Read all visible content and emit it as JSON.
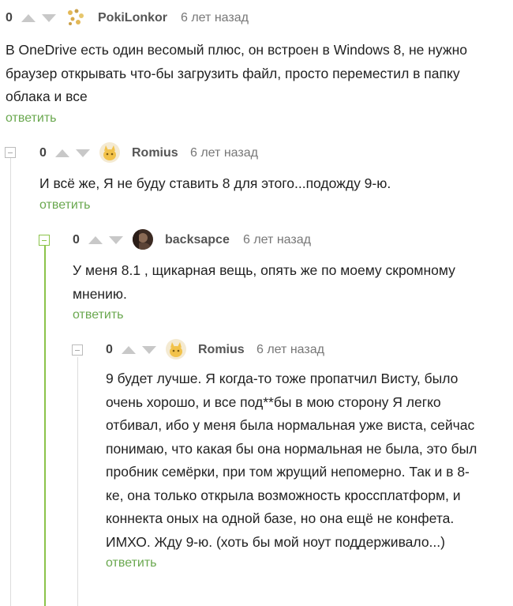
{
  "comments": [
    {
      "rating": "0",
      "nick": "PokiLonkor",
      "time": "6 лет назад",
      "text": "В OneDrive есть один весомый плюс, он встроен в Windows 8, не нужно браузер открывать что-бы загрузить файл, просто переместил в папку облака и все",
      "reply": "ответить",
      "avatar_icon": "pattern-avatar-icon"
    },
    {
      "rating": "0",
      "nick": "Romius",
      "time": "6 лет назад",
      "text": "И всё же, Я не буду ставить 8 для этого...подожду 9-ю.",
      "reply": "ответить",
      "avatar_icon": "cat-avatar-icon"
    },
    {
      "rating": "0",
      "nick": "backsapce",
      "time": "6 лет назад",
      "text": "У меня 8.1 , щикарная вещь, опять же по моему скромному мнению.",
      "reply": "ответить",
      "avatar_icon": "photo-avatar-icon"
    },
    {
      "rating": "0",
      "nick": "Romius",
      "time": "6 лет назад",
      "text": "9 будет лучше. Я когда-то тоже пропатчил Висту, было очень хорошо, и все под**бы в мою сторону Я легко отбивал, ибо у меня была нормальная уже виста, сейчас понимаю, что какая бы она нормальная не была, это был пробник семёрки, при том жрущий непомерно. Так и в 8-ке, она только открыла возможность кроссплатформ, и коннекта оных на одной базе, но она ещё не конфета. ИМХО. Жду 9-ю. (хоть бы мой ноут поддерживало...)",
      "reply": "ответить",
      "avatar_icon": "cat-avatar-icon"
    }
  ],
  "colors": {
    "reply_link": "#6aa84f",
    "active_thread": "#8bc34a",
    "inactive_thread": "#dddddd",
    "arrow": "#c8c8c8"
  }
}
